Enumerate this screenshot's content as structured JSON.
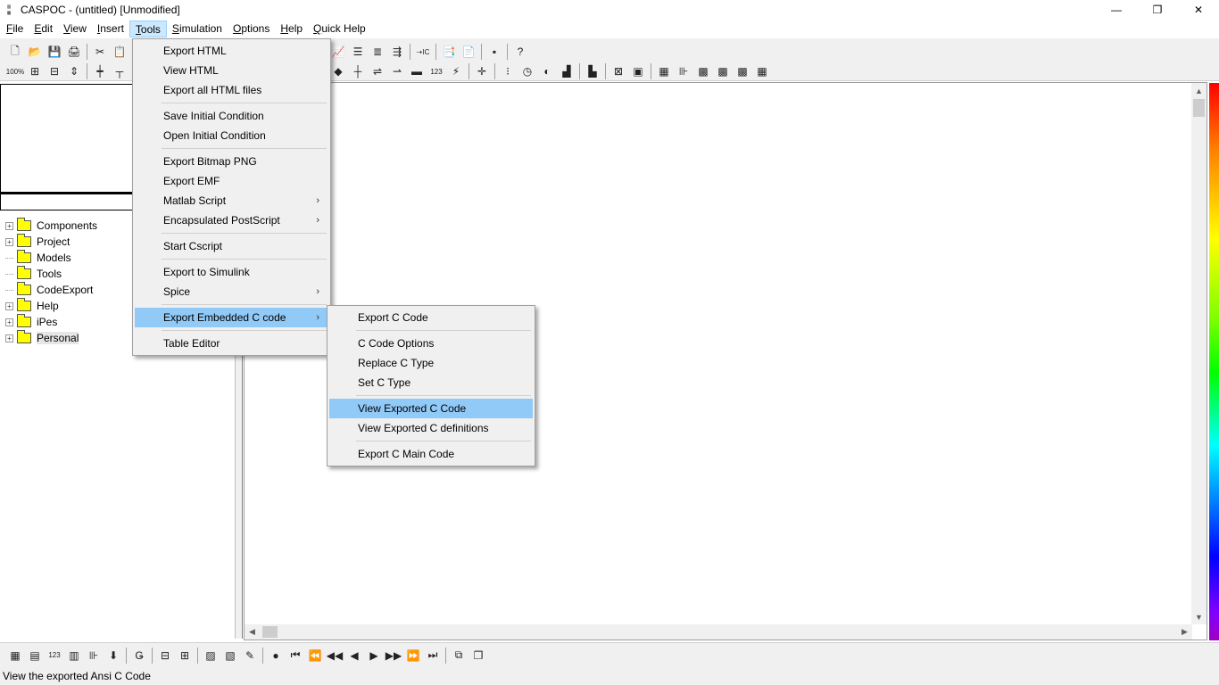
{
  "window": {
    "title": "CASPOC - (untitled) [Unmodified]",
    "icon_text": "CASPOC",
    "controls": [
      "—",
      "❐",
      "✕"
    ]
  },
  "menubar": {
    "items": [
      "File",
      "Edit",
      "View",
      "Insert",
      "Tools",
      "Simulation",
      "Options",
      "Help",
      "Quick Help"
    ],
    "active": "Tools"
  },
  "toolbar": {
    "row1": [
      "🗋",
      "📂",
      "💾",
      "🖨",
      "✂",
      "📋"
    ],
    "row1b": [
      "📈",
      "☰",
      "≣",
      "⇶",
      "⇢IC",
      "📑",
      "📄",
      "▪",
      "?"
    ],
    "row2": [
      "100%",
      "⊞",
      "⊟",
      "⇕",
      "┿",
      "┬"
    ],
    "row2b": [
      "◆",
      "┼",
      "⇌",
      "⇀",
      "▬",
      "123",
      "⚡",
      "✛",
      "⁝",
      "◷",
      "◐",
      "▟",
      "▙",
      "⊠",
      "▣",
      "▦",
      "⊪",
      "▩",
      "▩",
      "▩",
      "▦"
    ]
  },
  "tree": {
    "items": [
      {
        "label": "Components",
        "expander": "+"
      },
      {
        "label": "Project",
        "expander": "+"
      },
      {
        "label": "Models",
        "expander": ""
      },
      {
        "label": "Tools",
        "expander": ""
      },
      {
        "label": "CodeExport",
        "expander": ""
      },
      {
        "label": "Help",
        "expander": "+"
      },
      {
        "label": "iPes",
        "expander": "+"
      },
      {
        "label": "Personal",
        "expander": "+"
      }
    ],
    "selected": "Personal"
  },
  "tools_menu": {
    "groups": [
      [
        {
          "label": "Export HTML"
        },
        {
          "label": "View HTML"
        },
        {
          "label": "Export all HTML files"
        }
      ],
      [
        {
          "label": "Save Initial Condition"
        },
        {
          "label": "Open Initial Condition"
        }
      ],
      [
        {
          "label": "Export Bitmap PNG"
        },
        {
          "label": "Export EMF"
        },
        {
          "label": "Matlab Script",
          "submenu": true
        },
        {
          "label": "Encapsulated PostScript",
          "submenu": true
        }
      ],
      [
        {
          "label": "Start Cscript"
        }
      ],
      [
        {
          "label": "Export to Simulink"
        },
        {
          "label": "Spice",
          "submenu": true
        }
      ],
      [
        {
          "label": "Export Embedded C code",
          "submenu": true,
          "highlight": true
        }
      ],
      [
        {
          "label": "Table Editor"
        }
      ]
    ]
  },
  "embedded_c_menu": {
    "groups": [
      [
        {
          "label": "Export C Code"
        }
      ],
      [
        {
          "label": "C Code Options"
        },
        {
          "label": "Replace C Type"
        },
        {
          "label": "Set C Type"
        }
      ],
      [
        {
          "label": "View Exported C Code",
          "highlight": true
        },
        {
          "label": "View Exported C definitions"
        }
      ],
      [
        {
          "label": "Export C Main Code"
        }
      ]
    ]
  },
  "bottom_toolbar": [
    "▦",
    "▤",
    "123",
    "▥",
    "⊪",
    "⬇",
    "Ǥ",
    "⊟",
    "⊞",
    "▨",
    "▧",
    "✎",
    "●",
    "⏮",
    "⏪",
    "◀◀",
    "◀",
    "▶",
    "▶▶",
    "⏩",
    "⏭",
    "⧉",
    "❐"
  ],
  "status": {
    "text": "View the exported Ansi C Code"
  },
  "colors": {
    "menu_highlight": "#91c9f7",
    "menubar_active": "#cce8ff",
    "folder": "#ffff00"
  }
}
